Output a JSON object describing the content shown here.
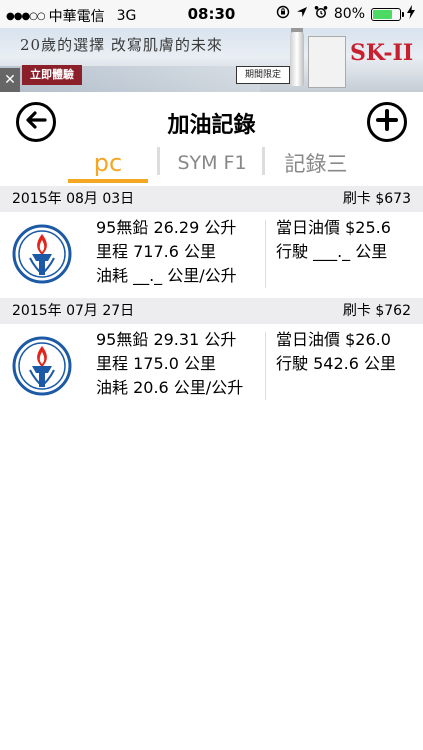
{
  "status": {
    "carrier": "中華電信",
    "network": "3G",
    "time": "08:30",
    "battery_percent": "80%",
    "battery_level": 0.8
  },
  "ad": {
    "headline": "20歲的選擇 改寫肌膚的未來",
    "cta": "立即體驗",
    "limited": "期間限定",
    "brand": "SK-II",
    "close": "✕"
  },
  "nav": {
    "title": "加油記錄",
    "back_icon": "back-arrow-icon",
    "add_icon": "plus-icon"
  },
  "tabs": [
    {
      "label": "pc",
      "active": true
    },
    {
      "label": "SYM F1",
      "active": false
    },
    {
      "label": "記錄三",
      "active": false
    }
  ],
  "records": [
    {
      "date": "2015年 08月 03日",
      "charge": "刷卡 $673",
      "fuel": "95無鉛 26.29 公升",
      "mileage": "里程 717.6 公里",
      "consumption": "油耗 __._ 公里/公升",
      "price": "當日油價 $25.6",
      "distance": "行駛 ___._ 公里"
    },
    {
      "date": "2015年 07月 27日",
      "charge": "刷卡 $762",
      "fuel": "95無鉛 29.31 公升",
      "mileage": "里程 175.0 公里",
      "consumption": "油耗 20.6 公里/公升",
      "price": "當日油價 $26.0",
      "distance": "行駛 542.6 公里"
    }
  ],
  "colors": {
    "accent": "#f5a623",
    "header_bg": "#ededf0",
    "logo_blue": "#1c5aa6",
    "logo_red": "#e1251b"
  }
}
